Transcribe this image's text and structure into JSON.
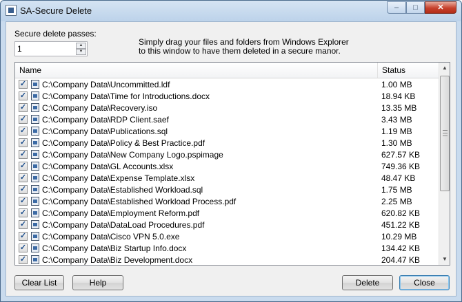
{
  "window": {
    "title": "SA-Secure Delete",
    "minimize": "–",
    "maximize": "□",
    "close": "✕"
  },
  "passes": {
    "label": "Secure delete passes:",
    "value": "1"
  },
  "instructions": [
    "Simply drag your files and folders from Windows Explorer",
    "to this window to have them deleted in a secure manor."
  ],
  "columns": {
    "name": "Name",
    "status": "Status"
  },
  "files": [
    {
      "path": "C:\\Company Data\\Uncommitted.ldf",
      "size": "1.00 MB"
    },
    {
      "path": "C:\\Company Data\\Time for Introductions.docx",
      "size": "18.94 KB"
    },
    {
      "path": "C:\\Company Data\\Recovery.iso",
      "size": "13.35 MB"
    },
    {
      "path": "C:\\Company Data\\RDP Client.saef",
      "size": "3.43 MB"
    },
    {
      "path": "C:\\Company Data\\Publications.sql",
      "size": "1.19 MB"
    },
    {
      "path": "C:\\Company Data\\Policy & Best Practice.pdf",
      "size": "1.30 MB"
    },
    {
      "path": "C:\\Company Data\\New Company Logo.pspimage",
      "size": "627.57 KB"
    },
    {
      "path": "C:\\Company Data\\GL Accounts.xlsx",
      "size": "749.36 KB"
    },
    {
      "path": "C:\\Company Data\\Expense Template.xlsx",
      "size": "48.47 KB"
    },
    {
      "path": "C:\\Company Data\\Established Workload.sql",
      "size": "1.75 MB"
    },
    {
      "path": "C:\\Company Data\\Established Workload Process.pdf",
      "size": "2.25 MB"
    },
    {
      "path": "C:\\Company Data\\Employment Reform.pdf",
      "size": "620.82 KB"
    },
    {
      "path": "C:\\Company Data\\DataLoad Procedures.pdf",
      "size": "451.22 KB"
    },
    {
      "path": "C:\\Company Data\\Cisco VPN 5.0.exe",
      "size": "10.29 MB"
    },
    {
      "path": "C:\\Company Data\\Biz Startup Info.docx",
      "size": "134.42 KB"
    },
    {
      "path": "C:\\Company Data\\Biz Development.docx",
      "size": "204.47 KB"
    }
  ],
  "buttons": {
    "clear": "Clear List",
    "help": "Help",
    "delete": "Delete",
    "close": "Close"
  },
  "colors": {
    "titlebar": "#c9dbee",
    "close_button": "#c7402c",
    "checkmark": "#1c4e8c",
    "default_button_border": "#3c7fb1"
  }
}
